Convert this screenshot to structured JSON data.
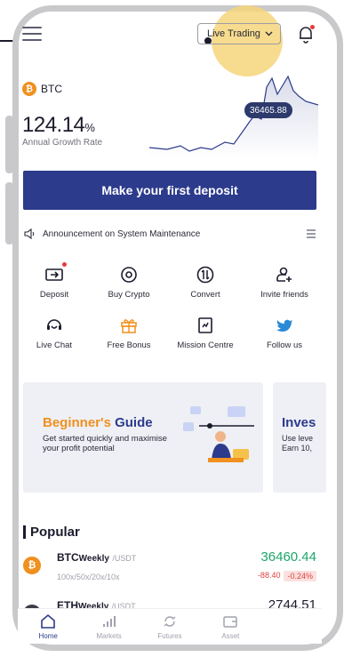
{
  "header": {
    "mode_label": "Live Trading",
    "icons": [
      "hamburger-icon",
      "chevron-down-icon",
      "bell-icon"
    ]
  },
  "hero": {
    "coin": "BTC",
    "growth_value": "124.14",
    "growth_unit": "%",
    "growth_label": "Annual Growth Rate",
    "price_tag": "36465.88"
  },
  "cta": {
    "label": "Make your first deposit"
  },
  "announcement": {
    "text": "Announcement on System Maintenance"
  },
  "actions": [
    {
      "label": "Deposit",
      "icon": "deposit-icon"
    },
    {
      "label": "Buy Crypto",
      "icon": "buy-crypto-icon"
    },
    {
      "label": "Convert",
      "icon": "convert-icon"
    },
    {
      "label": "Invite friends",
      "icon": "invite-icon"
    },
    {
      "label": "Live Chat",
      "icon": "live-chat-icon"
    },
    {
      "label": "Free Bonus",
      "icon": "gift-icon"
    },
    {
      "label": "Mission Centre",
      "icon": "mission-icon"
    },
    {
      "label": "Follow us",
      "icon": "twitter-icon"
    }
  ],
  "banners": [
    {
      "title_a": "Beginner's",
      "title_b": " Guide",
      "sub": "Get started quickly and maximise your profit potential"
    },
    {
      "title": "Inves",
      "sub_1": "Use leve",
      "sub_2": "Earn 10,"
    }
  ],
  "popular": {
    "title": "Popular",
    "rows": [
      {
        "base": "BTC",
        "weekly": "Weekly",
        "quote": "/USDT",
        "leverage": "100x/50x/20x/10x",
        "price": "36460.44",
        "change_abs": "-88.40",
        "change_pct": "-0.24%"
      },
      {
        "base": "ETH",
        "weekly": "Weekly",
        "quote": "/USDT",
        "price": "2744.51"
      }
    ]
  },
  "tabs": [
    {
      "label": "Home",
      "active": true
    },
    {
      "label": "Markets",
      "active": false
    },
    {
      "label": "Futures",
      "active": false
    },
    {
      "label": "Asset",
      "active": false
    }
  ],
  "colors": {
    "primary": "#2c3b8c",
    "accent_orange": "#f0901f",
    "up_green": "#1ca66a",
    "down_red": "#e0433f",
    "highlight": "#f6d57a"
  }
}
